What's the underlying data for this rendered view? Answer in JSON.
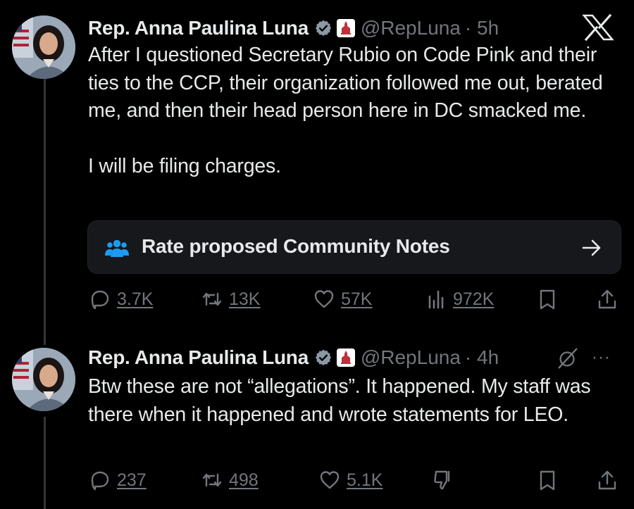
{
  "tweets": [
    {
      "author_name": "Rep. Anna Paulina Luna",
      "handle": "@RepLuna",
      "time": "· 5h",
      "paragraphs": [
        "After I questioned Secretary Rubio on Code Pink and their ties to the CCP, their organization followed me out, berated me, and then their head person here in DC smacked me.",
        "I will be filing charges."
      ],
      "community_note": {
        "label": "Rate proposed Community Notes"
      },
      "actions": {
        "replies": "3.7K",
        "reposts": "13K",
        "likes": "57K",
        "views": "972K"
      }
    },
    {
      "author_name": "Rep. Anna Paulina Luna",
      "handle": "@RepLuna",
      "time": "· 4h",
      "paragraphs": [
        "Btw these are not “allegations”. It happened. My staff was there when it happened and wrote statements for LEO."
      ],
      "more_label": "···",
      "actions": {
        "replies": "237",
        "reposts": "498",
        "likes": "5.1K"
      }
    }
  ],
  "colors": {
    "background": "#000000",
    "text": "#e7e9ea",
    "muted": "#71767b",
    "verified_gray": "#8b98a5",
    "community_icon": "#1d9bf0",
    "card": "#16181c"
  },
  "icons": {
    "brand": "x-logo-icon",
    "verified": "verified-badge-icon",
    "affiliation": "us-capitol-badge-icon",
    "community_notes": "community-notes-people-icon",
    "arrow": "arrow-right-icon",
    "reply": "reply-bubble-icon",
    "repost": "repost-icon",
    "like": "heart-icon",
    "views": "views-bar-chart-icon",
    "bookmark": "bookmark-icon",
    "share": "share-icon",
    "grok": "grok-slash-icon",
    "downvote": "downvote-icon"
  }
}
